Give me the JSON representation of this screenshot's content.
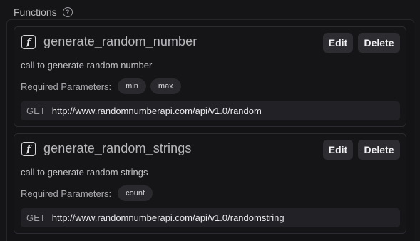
{
  "section": {
    "title": "Functions",
    "help_icon": "question-circle-icon"
  },
  "functions": [
    {
      "icon": "function-icon",
      "name": "generate_random_number",
      "description": "call to generate random number",
      "params_label": "Required Parameters:",
      "params": [
        "min",
        "max"
      ],
      "method": "GET",
      "url": "http://www.randomnumberapi.com/api/v1.0/random",
      "edit_label": "Edit",
      "delete_label": "Delete"
    },
    {
      "icon": "function-icon",
      "name": "generate_random_strings",
      "description": "call to generate random strings",
      "params_label": "Required Parameters:",
      "params": [
        "count"
      ],
      "method": "GET",
      "url": "http://www.randomnumberapi.com/api/v1.0/randomstring",
      "edit_label": "Edit",
      "delete_label": "Delete"
    }
  ],
  "colors": {
    "background": "#151517",
    "card_border": "#2b2b30",
    "button_bg": "#2d2d31",
    "pill_bg": "#2a2a2e",
    "endpoint_bg": "#222226"
  }
}
